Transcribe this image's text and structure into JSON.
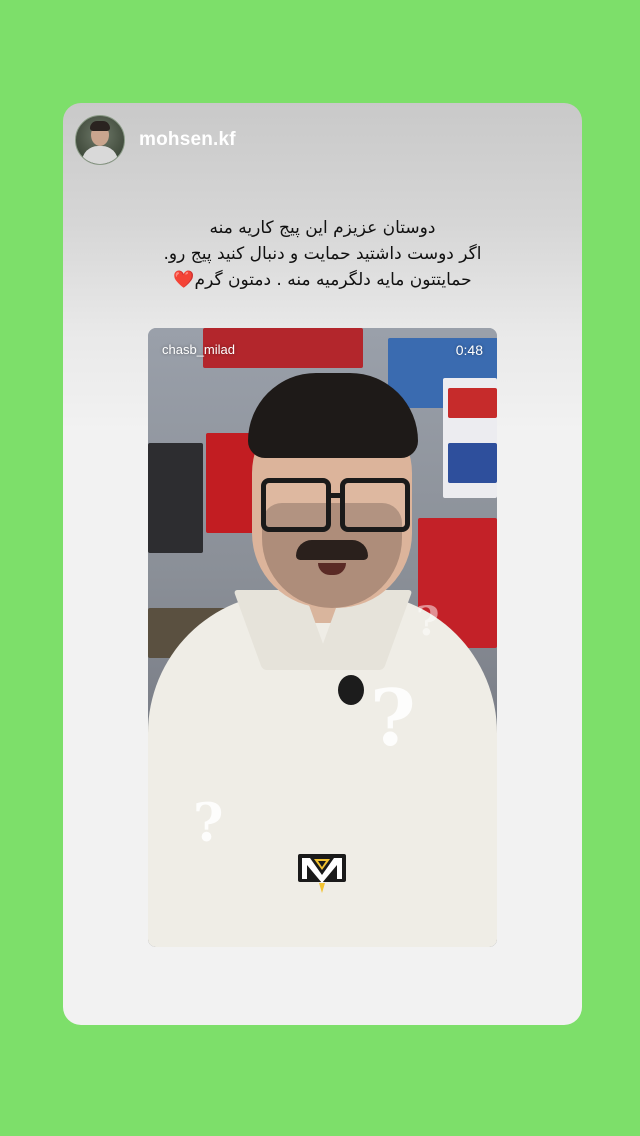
{
  "story": {
    "username": "mohsen.kf",
    "caption_lines": [
      "دوستان عزیزم این پیج کاریه منه",
      "اگر دوست داشتید حمایت و دنبال کنید پیج رو.",
      "حمایتتون مایه دلگرمیه منه . دمتون گرم❤️"
    ]
  },
  "video": {
    "source_username": "chasb_milad",
    "duration": "0:48"
  },
  "icons": {
    "avatar": "profile-avatar-icon",
    "logo": "channel-logo-icon",
    "question_marks": "question-mark-icon"
  },
  "colors": {
    "background": "#7ddf6a",
    "card": "#f2f2f2",
    "username_text": "#ffffff"
  }
}
